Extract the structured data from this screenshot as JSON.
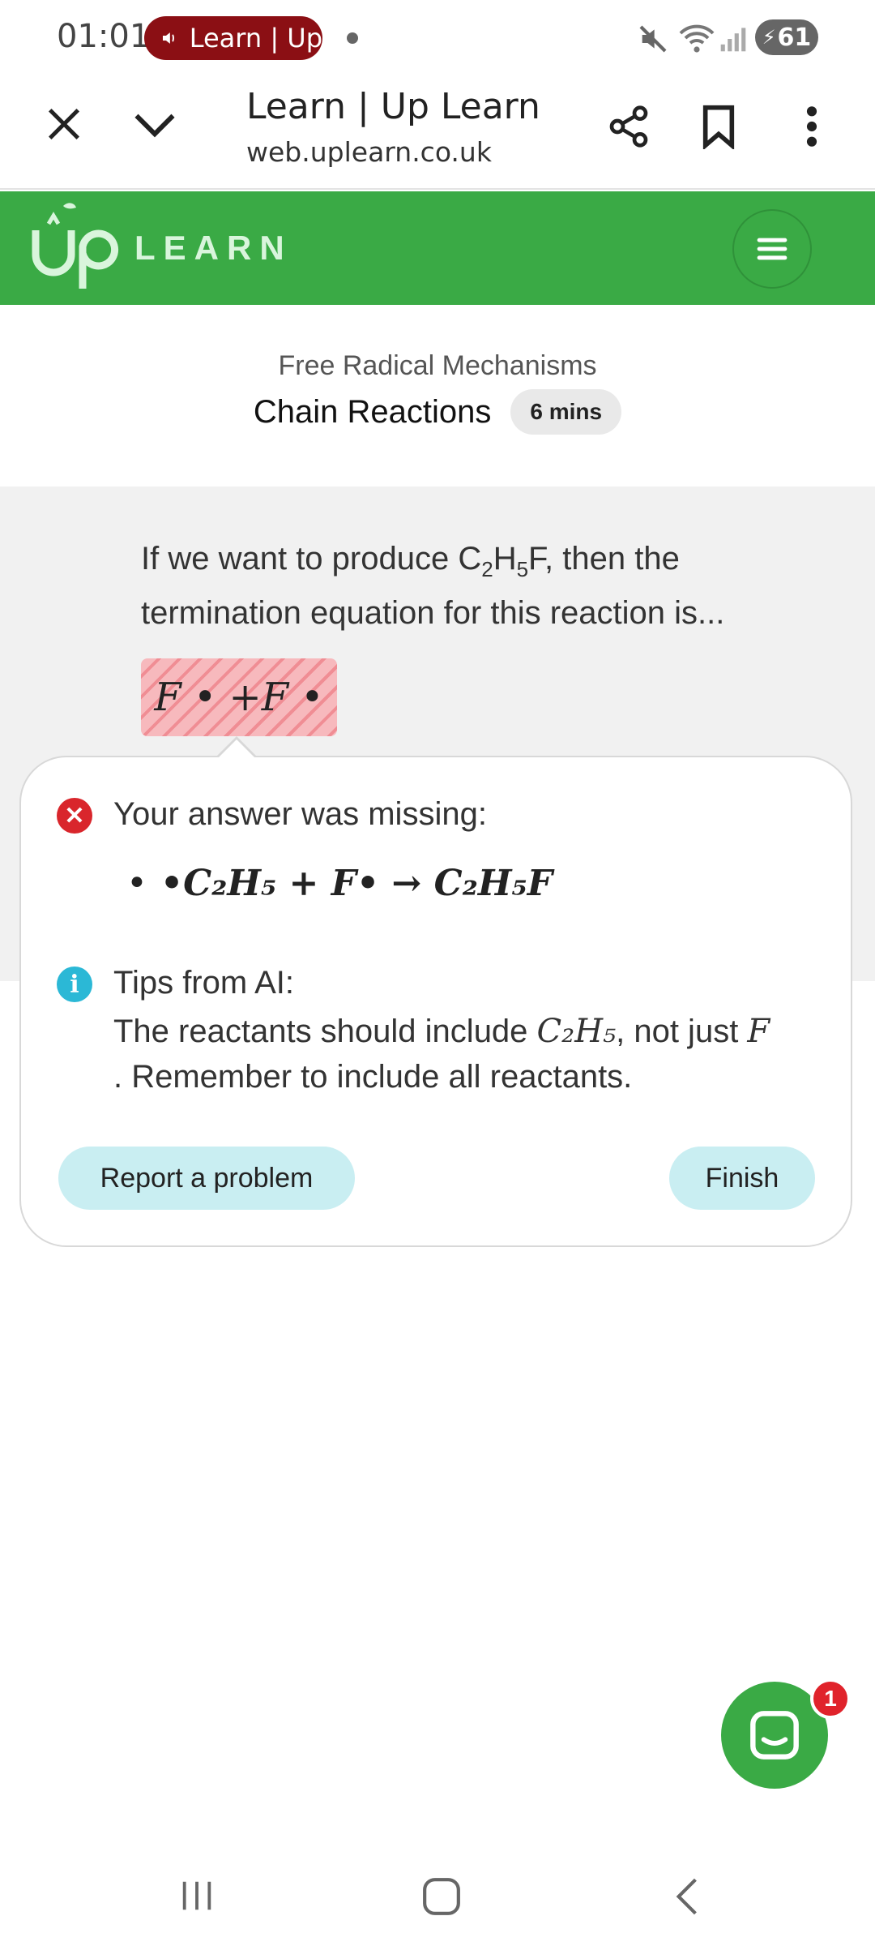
{
  "status_bar": {
    "time": "01:01",
    "media_label": "Learn | Up",
    "battery": "61"
  },
  "browser": {
    "title": "Learn | Up Learn",
    "url": "web.uplearn.co.uk",
    "icons": [
      "close-icon",
      "chevron-down-icon",
      "share-icon",
      "bookmark-icon",
      "more-vert-icon"
    ]
  },
  "header": {
    "logo_up": "Up",
    "logo_word": "LEARN"
  },
  "lesson": {
    "topic": "Free Radical Mechanisms",
    "title": "Chain Reactions",
    "duration": "6 mins"
  },
  "question": {
    "text_before": "If we want to produce C",
    "text_sub1": "2",
    "text_mid": "H",
    "text_sub2": "5",
    "text_after": "F, then the termination equation for this reaction is...",
    "answer": "F • +F •"
  },
  "feedback": {
    "missing_label": "Your answer was missing:",
    "missing_items": [
      "•C₂H₅ + F• → C₂H₅F"
    ],
    "tips_label": "Tips from AI:",
    "tips_part1": "The reactants should include ",
    "tips_math1": "C₂H₅",
    "tips_part2": ", not just ",
    "tips_math2": "F",
    "tips_part3": ". Remember to include all reactants.",
    "report_label": "Report a problem",
    "finish_label": "Finish"
  },
  "chat": {
    "badge_count": "1"
  },
  "colors": {
    "brand_green": "#3aaa45",
    "error_red": "#d9262c",
    "info_cyan": "#2bb8d6",
    "button_bg": "#c9eef2"
  }
}
